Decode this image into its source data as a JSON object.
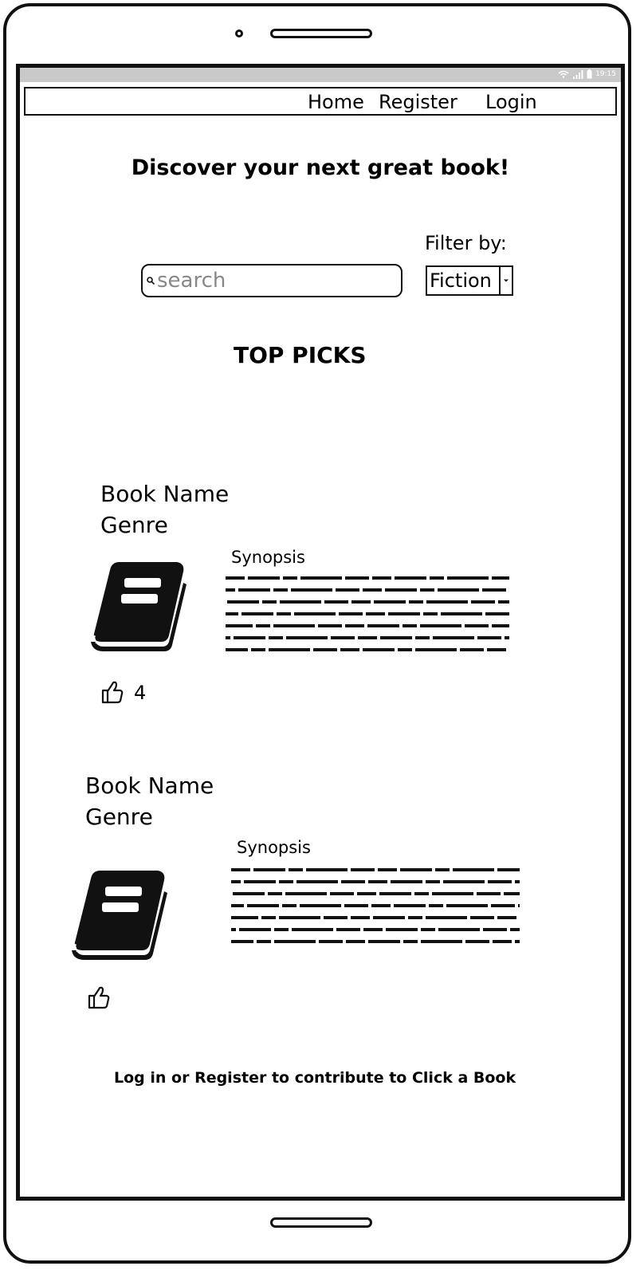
{
  "status_bar": {
    "time": "19:15"
  },
  "nav": {
    "home": "Home",
    "register": "Register",
    "login": "Login"
  },
  "headline": "Discover your next great book!",
  "filter": {
    "label": "Filter by:",
    "selected": "Fiction"
  },
  "search": {
    "placeholder": "search",
    "value": ""
  },
  "section_title": "TOP PICKS",
  "books": [
    {
      "name": "Book Name",
      "genre": "Genre",
      "synopsis_label": "Synopsis",
      "likes": "4"
    },
    {
      "name": "Book Name",
      "genre": "Genre",
      "synopsis_label": "Synopsis",
      "likes": ""
    }
  ],
  "footer": "Log in or Register to contribute to Click a Book",
  "icons": [
    "wifi-icon",
    "signal-icon",
    "battery-icon",
    "search-icon",
    "chevron-down-icon",
    "book-icon",
    "thumbs-up-icon"
  ]
}
